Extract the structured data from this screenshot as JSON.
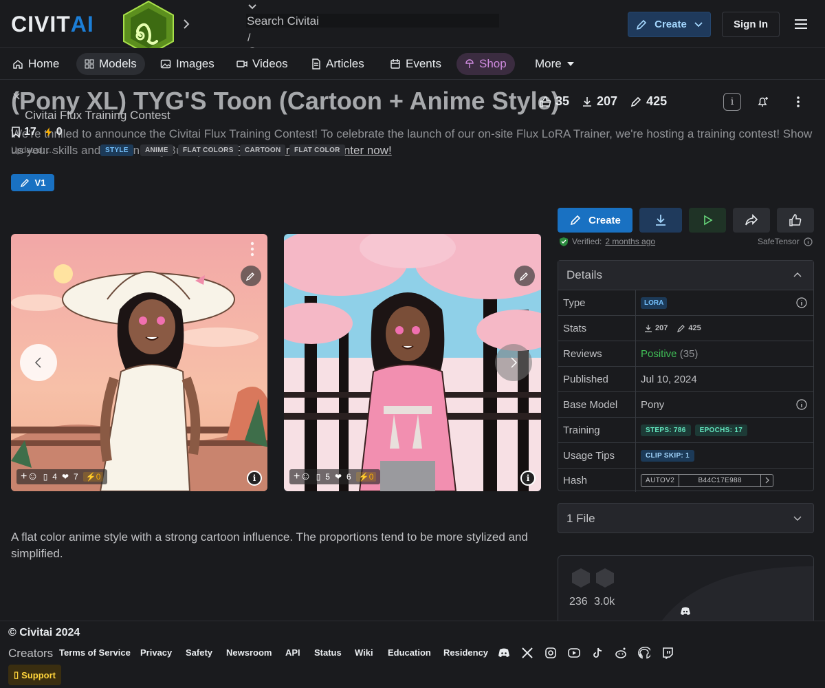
{
  "header": {
    "logo_text": "CIVITAI",
    "search_placeholder": "Search Civitai",
    "search_shortcut": "/",
    "create_label": "Create",
    "signin_label": "Sign In"
  },
  "nav": {
    "items": [
      {
        "label": "Home",
        "icon": "home-icon"
      },
      {
        "label": "Models",
        "icon": "grid-icon"
      },
      {
        "label": "Images",
        "icon": "image-icon"
      },
      {
        "label": "Videos",
        "icon": "video-icon"
      },
      {
        "label": "Articles",
        "icon": "article-icon"
      },
      {
        "label": "Events",
        "icon": "calendar-icon"
      },
      {
        "label": "Shop",
        "icon": "shop-icon"
      },
      {
        "label": "More",
        "icon": "caret-down-icon"
      }
    ]
  },
  "announcement": {
    "title": "Civitai Flux Training Contest",
    "text_1": "We're thrilled to announce the Civitai Flux Training Contest! To celebrate the launch of our on-site Flux LoRA Trainer, we're hosting a training contest! Show",
    "text_2": "us your skills and ... e and big Buzz prizes!",
    "link": "Read the rules and enter now!"
  },
  "model": {
    "title": "(Pony XL) TYG'S Toon (Cartoon + Anime Style)",
    "likes": "35",
    "downloads": "207",
    "generations": "425",
    "bookmarks": "17",
    "buzz": "0",
    "updated": "Updated: ...",
    "tags": [
      "STYLE",
      "ANIME",
      "FLAT COLORS",
      "CARTOON",
      "FLAT COLOR"
    ],
    "version": "V1",
    "description": "A flat color anime style with a strong cartoon influence. The proportions tend to be more stylized and simplified."
  },
  "images": [
    {
      "comments": "4",
      "likes": "7",
      "buzz": "0"
    },
    {
      "comments": "5",
      "likes": "6",
      "buzz": "0"
    }
  ],
  "actions": {
    "create_label": "Create",
    "verified_label": "Verified:",
    "verified_time": "2 months ago",
    "format": "SafeTensor"
  },
  "details": {
    "heading": "Details",
    "rows": {
      "type_k": "Type",
      "type_v": "LORA",
      "stats_k": "Stats",
      "stats_downloads": "207",
      "stats_generations": "425",
      "reviews_k": "Reviews",
      "reviews_v": "Positive",
      "reviews_count": "(35)",
      "published_k": "Published",
      "published_v": "Jul 10, 2024",
      "base_k": "Base Model",
      "base_v": "Pony",
      "training_k": "Training",
      "training_steps": "STEPS: 786",
      "training_epochs": "EPOCHS: 17",
      "tips_k": "Usage Tips",
      "tips_v": "CLIP SKIP: 1",
      "hash_k": "Hash",
      "hash_type": "AUTOV2",
      "hash_v": "B44C17E988"
    }
  },
  "files": {
    "label": "1 File"
  },
  "creator": {
    "stat_1": "236",
    "stat_2": "3.0k"
  },
  "footer": {
    "copyright": "© Civitai 2024",
    "creators": "Creators",
    "links": [
      "Terms of Service",
      "Privacy",
      "Safety",
      "Newsroom",
      "API",
      "Status",
      "Wiki",
      "Education",
      "Residency"
    ],
    "support": "Support"
  },
  "colors": {
    "accent": "#228be6",
    "shop": "#d08be0",
    "positive": "#40c057",
    "teal_badge": "#63e6be"
  }
}
